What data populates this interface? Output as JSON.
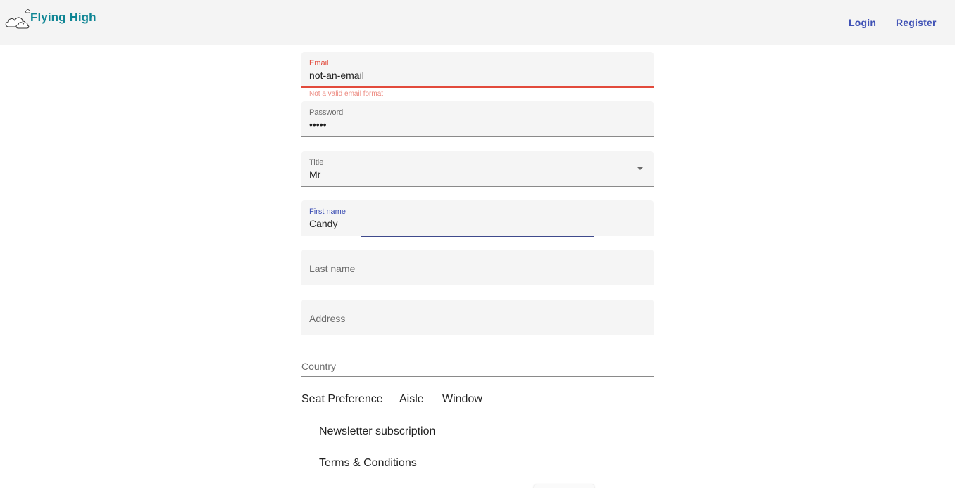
{
  "app": {
    "brand": "Flying High",
    "logo_icon": "cloud-logo-icon"
  },
  "nav": {
    "login": "Login",
    "register": "Register"
  },
  "form": {
    "email": {
      "label": "Email",
      "value": "not-an-email",
      "error": "Not a valid email format"
    },
    "password": {
      "label": "Password",
      "value": "•••••"
    },
    "title": {
      "label": "Title",
      "value": "Mr"
    },
    "first_name": {
      "label": "First name",
      "value": "Candy"
    },
    "last_name": {
      "placeholder": "Last name"
    },
    "address": {
      "placeholder": "Address"
    },
    "country": {
      "placeholder": "Country"
    },
    "seat_preference": {
      "label": "Seat Preference",
      "options": [
        "Aisle",
        "Window"
      ]
    },
    "newsletter": {
      "label": "Newsletter subscription"
    },
    "terms": {
      "label": "Terms & Conditions"
    }
  },
  "colors": {
    "brand": "#0e8594",
    "accent": "#3f51b5",
    "error": "#e24a3b",
    "topbar": "#f4f4f4",
    "field": "#f5f5f5"
  }
}
